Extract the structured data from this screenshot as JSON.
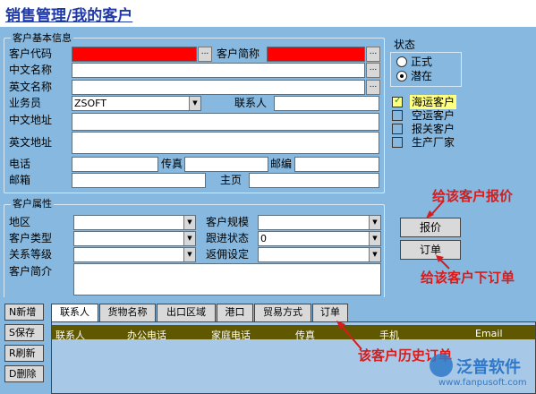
{
  "title": "销售管理/我的客户",
  "basic_info": {
    "legend": "客户基本信息",
    "customer_code_label": "客户代码",
    "customer_short_label": "客户简称",
    "chinese_name_label": "中文名称",
    "english_name_label": "英文名称",
    "salesman_label": "业务员",
    "salesman_value": "ZSOFT",
    "contact_label": "联系人",
    "cn_address_label": "中文地址",
    "en_address_label": "英文地址",
    "phone_label": "电话",
    "fax_label": "传真",
    "postcode_label": "邮编",
    "email_label": "邮箱",
    "homepage_label": "主页",
    "dots": "..."
  },
  "status": {
    "label": "状态",
    "options": [
      "正式",
      "潜在"
    ],
    "selected": "潜在"
  },
  "customer_types": [
    {
      "label": "海运客户",
      "checked": true
    },
    {
      "label": "空运客户",
      "checked": false
    },
    {
      "label": "报关客户",
      "checked": false
    },
    {
      "label": "生产厂家",
      "checked": false
    }
  ],
  "attributes": {
    "legend": "客户属性",
    "region_label": "地区",
    "scale_label": "客户规模",
    "type_label": "客户类型",
    "follow_label": "跟进状态",
    "follow_value": "0",
    "relation_label": "关系等级",
    "return_label": "返佣设定",
    "intro_label": "客户简介"
  },
  "actions": {
    "quote": "报价",
    "order": "订单"
  },
  "annotations": {
    "quote": "给该客户报价",
    "order": "给该客户下订单",
    "history": "该客户历史订单"
  },
  "left_buttons": [
    "N新增",
    "S保存",
    "R刷新",
    "D删除"
  ],
  "tabs": [
    "联系人",
    "货物名称",
    "出口区域",
    "港口",
    "贸易方式",
    "订单"
  ],
  "table_columns": [
    "联系人",
    "办公电话",
    "家庭电话",
    "传真",
    "手机",
    "Email"
  ],
  "watermark": {
    "brand": "泛普软件",
    "url": "www.fanpusoft.com"
  },
  "colors": {
    "background": "#71a6cf",
    "panel": "#87b9e0",
    "required_field": "#ff0000",
    "table_header": "#5f5800",
    "annotation": "#d81b1b"
  }
}
